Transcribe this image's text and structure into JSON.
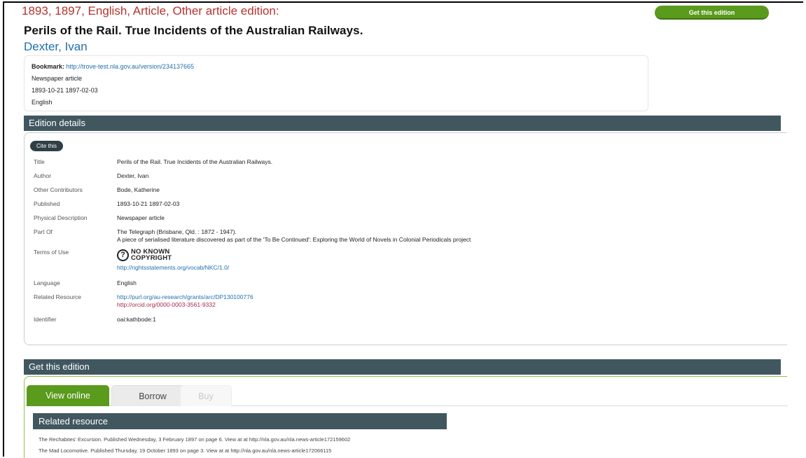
{
  "header": {
    "edition_line": "1893, 1897, English, Article, Other article edition:",
    "title": "Perils of the Rail. True Incidents of the Australian Railways.",
    "author": "Dexter, Ivan",
    "get_edition_button": "Get this edition"
  },
  "summary": {
    "bookmark_label": "Bookmark:",
    "bookmark_url": "http://trove-test.nla.gov.au/version/234137665",
    "format": "Newspaper article",
    "dates": "1893-10-21 1897-02-03",
    "language": "English"
  },
  "edition_details": {
    "heading": "Edition details",
    "cite_button": "Cite this",
    "rows": {
      "title": {
        "label": "Title",
        "value": "Perils of the Rail. True Incidents of the Australian Railways."
      },
      "author": {
        "label": "Author",
        "value": "Dexter, Ivan"
      },
      "contributors": {
        "label": "Other Contributors",
        "value": "Bode, Katherine"
      },
      "published": {
        "label": "Published",
        "value": "1893-10-21 1897-02-03"
      },
      "physical": {
        "label": "Physical Description",
        "value": "Newspaper article"
      },
      "part_of": {
        "label": "Part Of",
        "value": "The Telegraph (Brisbane, Qld. : 1872 - 1947).",
        "value2": "A piece of serialised literature discovered as part of the 'To Be Continued': Exploring the World of Novels in Colonial Periodicals project"
      },
      "terms": {
        "label": "Terms of Use",
        "badge_line1": "NO KNOWN",
        "badge_line2": "COPYRIGHT",
        "badge_glyph": "?",
        "link": "http://rightsstatements.org/vocab/NKC/1.0/"
      },
      "language": {
        "label": "Language",
        "value": "English"
      },
      "related": {
        "label": "Related Resource",
        "link1": "http://purl.org/au-research/grants/arc/DP130100776",
        "link2": "http://orcid.org/0000-0003-3561-9332"
      },
      "identifier": {
        "label": "Identifier",
        "value": "oai:kathbode:1"
      }
    }
  },
  "get_edition": {
    "heading": "Get this edition",
    "tabs": [
      "View online",
      "Borrow",
      "Buy"
    ],
    "related_heading": "Related resource",
    "related_items": [
      "The Rechabites' Excursion. Published Wednesday, 3 February 1897 on page 6. View at at http://nla.gov.au/nla.news-article172159602",
      "The Mad Locomotive. Published Thursday, 19 October 1893 on page 3. View at at http://nla.gov.au/nla.news-article172066115"
    ]
  },
  "colors": {
    "edition_line": "#b5332e",
    "link": "#1f6fae",
    "section_bar": "#415760",
    "accent_green": "#5a9a1c",
    "orcid_link": "#a8284a"
  }
}
